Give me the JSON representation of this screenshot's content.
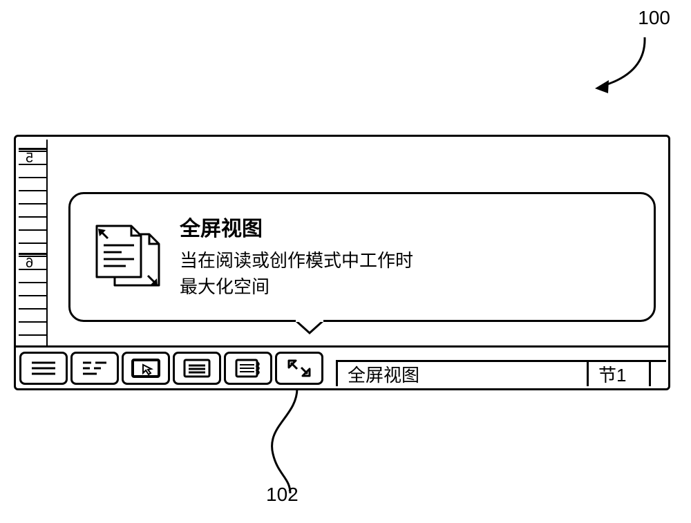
{
  "figure": {
    "number": "100",
    "callout": "102"
  },
  "ruler": {
    "mark_a": "5",
    "mark_b": "6"
  },
  "tooltip": {
    "title": "全屏视图",
    "line1": "当在阅读或创作模式中工作时",
    "line2": "最大化空间"
  },
  "statusbar": {
    "view_label": "全屏视图",
    "section_label": "节1"
  }
}
